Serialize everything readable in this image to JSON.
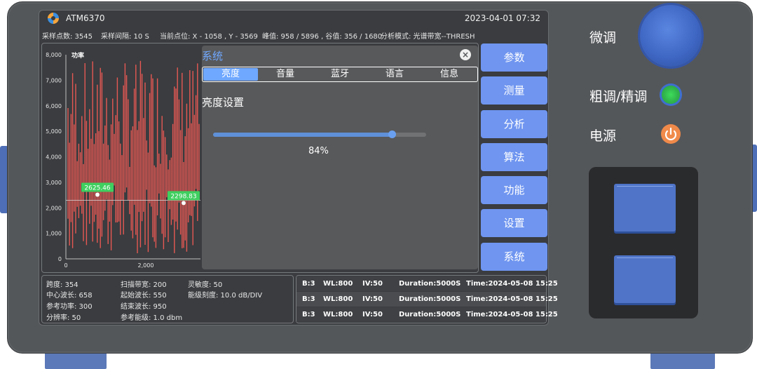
{
  "header": {
    "device_name": "ATM6370",
    "datetime": "2023-04-01 07:32"
  },
  "info": {
    "sample_points": "采样点数: 3545",
    "sample_interval": "采样间隔: 10 S",
    "current_point": "当前点位: X - 1058 , Y - 3569",
    "peak_valley": "峰值: 958 / 5896 , 谷值: 356 / 1680",
    "analysis_mode": "分析模式: 光谱带宽--THRESH"
  },
  "chart_data": {
    "type": "bar",
    "ylabel": "功率",
    "ylim": [
      0,
      8000
    ],
    "yticks": [
      "8,000",
      "7,000",
      "6,000",
      "5,000",
      "4,000",
      "3,000",
      "2,000",
      "1,000",
      "0"
    ],
    "xticks": [
      "0",
      "2,000"
    ],
    "threshold": 2300,
    "markers": [
      {
        "label": "2625.46",
        "value": 2625.46
      },
      {
        "label": "2298.83",
        "value": 2298.83
      }
    ],
    "color": "#f05a55"
  },
  "system_panel": {
    "title": "系统",
    "tabs": [
      "亮度",
      "音量",
      "蓝牙",
      "语言",
      "信息"
    ],
    "active_tab": "亮度",
    "section_title": "亮度设置",
    "brightness_value": 0.84,
    "brightness_label": "84%"
  },
  "side_menu": [
    "参数",
    "测量",
    "分析",
    "算法",
    "功能",
    "设置",
    "系统"
  ],
  "params": {
    "span": "跨度: 354",
    "scan_bw": "扫描带宽: 200",
    "sensitivity": "灵敏度: 50",
    "center_wl": "中心波长: 658",
    "start_wl": "起始波长: 550",
    "level_scale": "能级刻度: 10.0 dB/DIV",
    "ref_power": "参考功率: 300",
    "end_wl": "结束波长: 950",
    "resolution": "分辨率: 50",
    "ref_level": "参考能级: 1.0 dbm"
  },
  "log": [
    {
      "b": "B:3",
      "wl": "WL:800",
      "iv": "IV:50",
      "duration": "Duration:5000S",
      "time": "Time:2024-05-08 15:25"
    },
    {
      "b": "B:3",
      "wl": "WL:800",
      "iv": "IV:50",
      "duration": "Duration:5000S",
      "time": "Time:2024-05-08 15:25"
    },
    {
      "b": "B:3",
      "wl": "WL:800",
      "iv": "IV:50",
      "duration": "Duration:5000S",
      "time": "Time:2024-05-08 15:25"
    }
  ],
  "controls": {
    "fine_tune": "微调",
    "coarse_fine": "粗调/精调",
    "power": "电源"
  },
  "colors": {
    "accent": "#6f95f0",
    "led_green": "#3ddc5a",
    "power_orange": "#f08a4a"
  }
}
